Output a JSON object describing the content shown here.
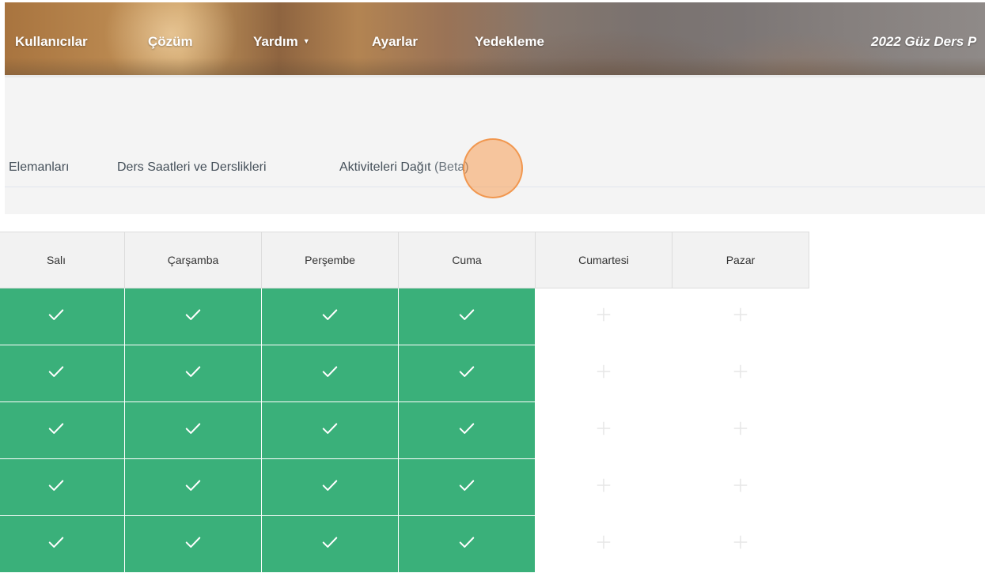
{
  "nav": {
    "items": [
      "Kullanıcılar",
      "Çözüm",
      "Yardım",
      "Ayarlar",
      "Yedekleme"
    ],
    "brand": "2022 Güz Ders P"
  },
  "tabs": {
    "items": [
      "Elemanları",
      "Ders Saatleri ve Derslikleri",
      "Aktiviteleri Dağıt"
    ],
    "beta": "(Beta)"
  },
  "table": {
    "headers": [
      "Salı",
      "Çarşamba",
      "Perşembe",
      "Cuma",
      "Cumartesi",
      "Pazar"
    ],
    "rows": [
      [
        "on",
        "on",
        "on",
        "on",
        "off",
        "off"
      ],
      [
        "on",
        "on",
        "on",
        "on",
        "off",
        "off"
      ],
      [
        "on",
        "on",
        "on",
        "on",
        "off",
        "off"
      ],
      [
        "on",
        "on",
        "on",
        "on",
        "off",
        "off"
      ],
      [
        "on",
        "on",
        "on",
        "on",
        "off",
        "off"
      ]
    ]
  },
  "colors": {
    "selected": "#3ab07a",
    "header_bg": "#f2f2f2",
    "highlight": "#f79646"
  },
  "icons": {
    "selected_cell": "check-icon",
    "empty_cell": "plus-icon",
    "dropdown": "caret-down-icon"
  }
}
